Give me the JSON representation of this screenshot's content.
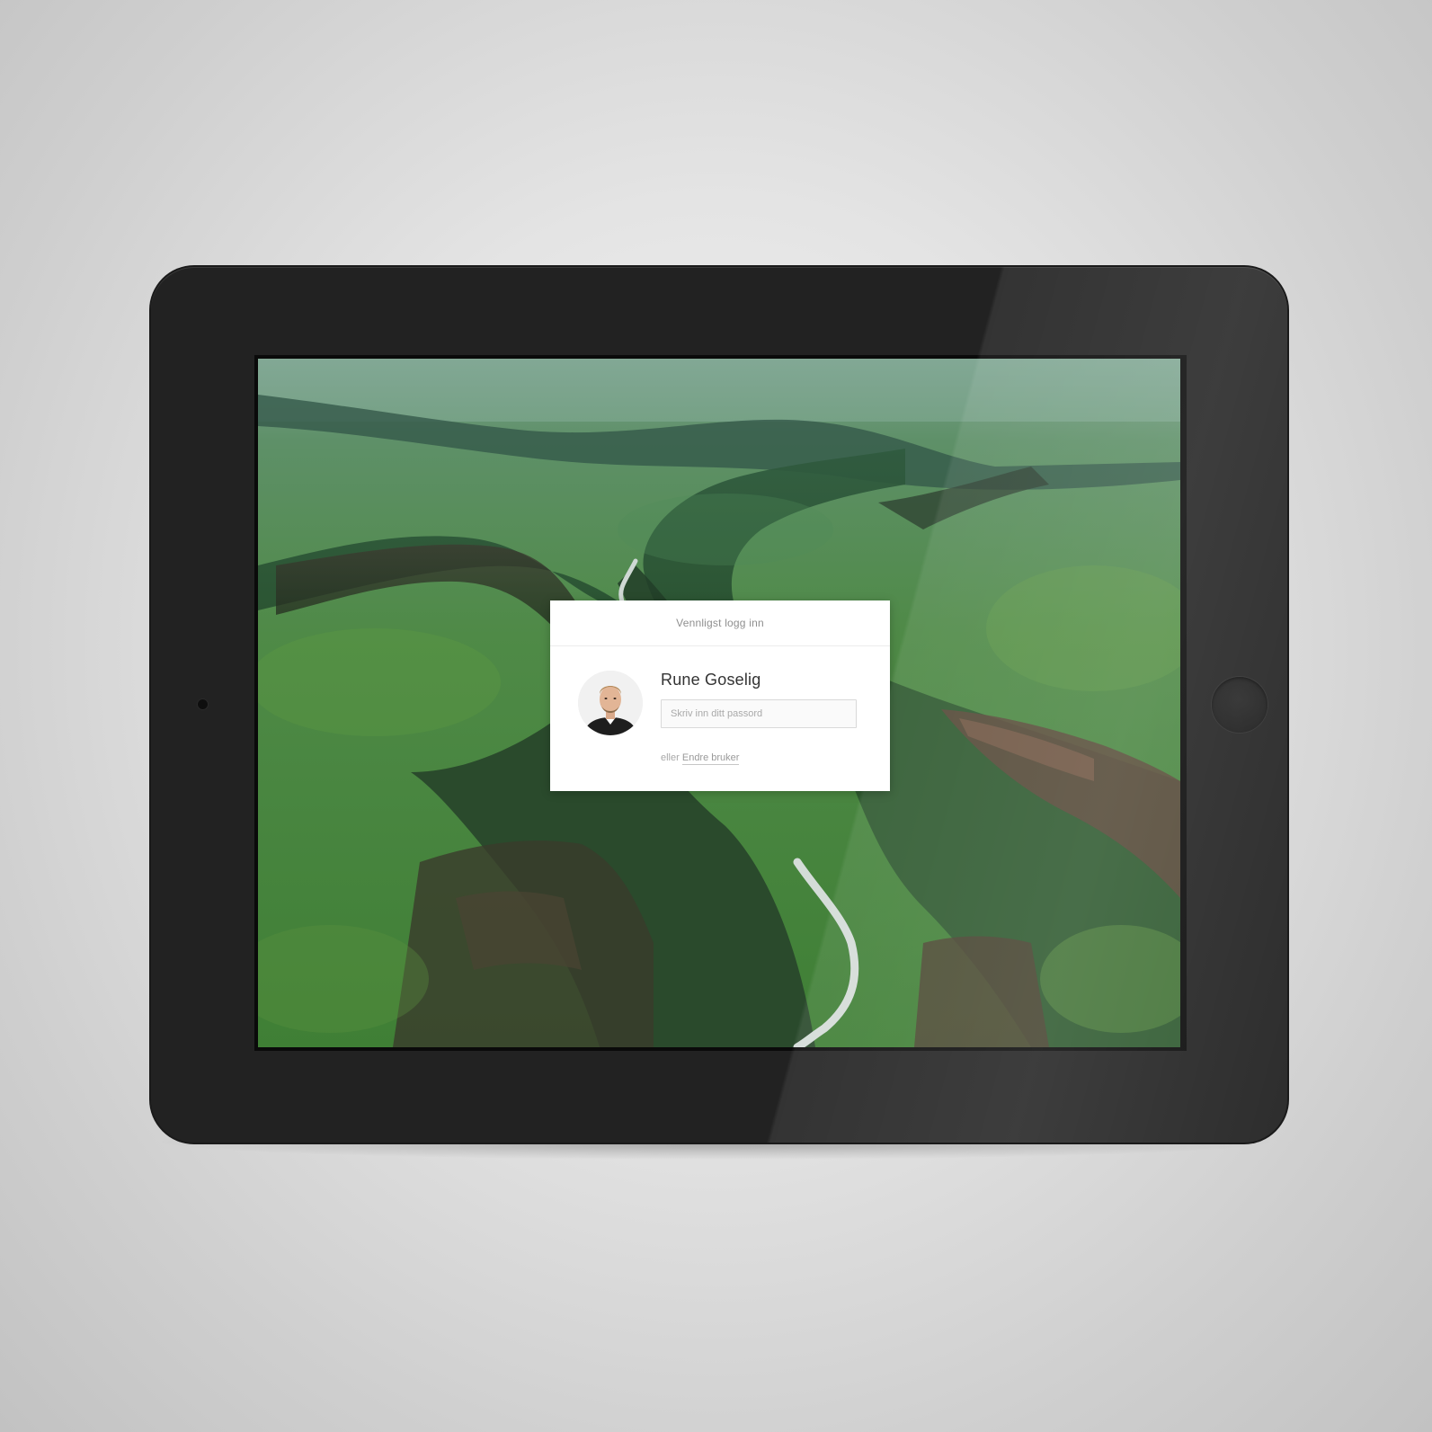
{
  "login": {
    "header": "Vennligst logg inn",
    "user_name": "Rune Goselig",
    "password_placeholder": "Skriv inn ditt passord",
    "alt_prefix": "eller",
    "change_user_link": "Endre bruker"
  },
  "icons": {
    "avatar": "user-avatar-photo",
    "camera": "front-camera-icon",
    "home_button": "home-button-icon"
  },
  "colors": {
    "device_body": "#222222",
    "card_background": "#ffffff",
    "wallpaper_green": "#3e7a3a"
  }
}
